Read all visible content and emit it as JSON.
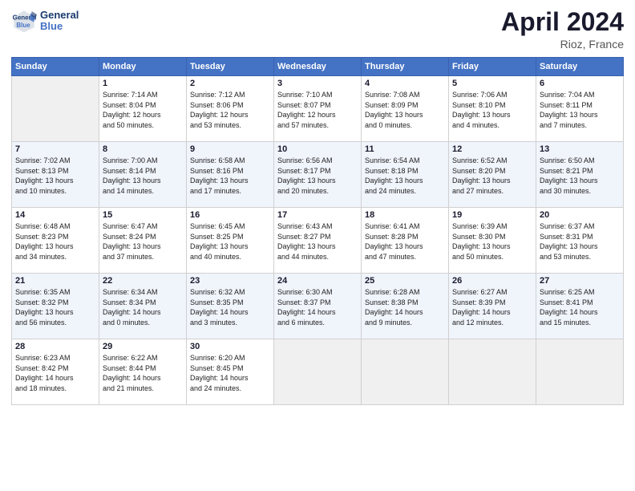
{
  "header": {
    "logo_line1": "General",
    "logo_line2": "Blue",
    "title": "April 2024",
    "location": "Rioz, France"
  },
  "days_of_week": [
    "Sunday",
    "Monday",
    "Tuesday",
    "Wednesday",
    "Thursday",
    "Friday",
    "Saturday"
  ],
  "weeks": [
    [
      {
        "day": "",
        "info": ""
      },
      {
        "day": "1",
        "info": "Sunrise: 7:14 AM\nSunset: 8:04 PM\nDaylight: 12 hours\nand 50 minutes."
      },
      {
        "day": "2",
        "info": "Sunrise: 7:12 AM\nSunset: 8:06 PM\nDaylight: 12 hours\nand 53 minutes."
      },
      {
        "day": "3",
        "info": "Sunrise: 7:10 AM\nSunset: 8:07 PM\nDaylight: 12 hours\nand 57 minutes."
      },
      {
        "day": "4",
        "info": "Sunrise: 7:08 AM\nSunset: 8:09 PM\nDaylight: 13 hours\nand 0 minutes."
      },
      {
        "day": "5",
        "info": "Sunrise: 7:06 AM\nSunset: 8:10 PM\nDaylight: 13 hours\nand 4 minutes."
      },
      {
        "day": "6",
        "info": "Sunrise: 7:04 AM\nSunset: 8:11 PM\nDaylight: 13 hours\nand 7 minutes."
      }
    ],
    [
      {
        "day": "7",
        "info": "Sunrise: 7:02 AM\nSunset: 8:13 PM\nDaylight: 13 hours\nand 10 minutes."
      },
      {
        "day": "8",
        "info": "Sunrise: 7:00 AM\nSunset: 8:14 PM\nDaylight: 13 hours\nand 14 minutes."
      },
      {
        "day": "9",
        "info": "Sunrise: 6:58 AM\nSunset: 8:16 PM\nDaylight: 13 hours\nand 17 minutes."
      },
      {
        "day": "10",
        "info": "Sunrise: 6:56 AM\nSunset: 8:17 PM\nDaylight: 13 hours\nand 20 minutes."
      },
      {
        "day": "11",
        "info": "Sunrise: 6:54 AM\nSunset: 8:18 PM\nDaylight: 13 hours\nand 24 minutes."
      },
      {
        "day": "12",
        "info": "Sunrise: 6:52 AM\nSunset: 8:20 PM\nDaylight: 13 hours\nand 27 minutes."
      },
      {
        "day": "13",
        "info": "Sunrise: 6:50 AM\nSunset: 8:21 PM\nDaylight: 13 hours\nand 30 minutes."
      }
    ],
    [
      {
        "day": "14",
        "info": "Sunrise: 6:48 AM\nSunset: 8:23 PM\nDaylight: 13 hours\nand 34 minutes."
      },
      {
        "day": "15",
        "info": "Sunrise: 6:47 AM\nSunset: 8:24 PM\nDaylight: 13 hours\nand 37 minutes."
      },
      {
        "day": "16",
        "info": "Sunrise: 6:45 AM\nSunset: 8:25 PM\nDaylight: 13 hours\nand 40 minutes."
      },
      {
        "day": "17",
        "info": "Sunrise: 6:43 AM\nSunset: 8:27 PM\nDaylight: 13 hours\nand 44 minutes."
      },
      {
        "day": "18",
        "info": "Sunrise: 6:41 AM\nSunset: 8:28 PM\nDaylight: 13 hours\nand 47 minutes."
      },
      {
        "day": "19",
        "info": "Sunrise: 6:39 AM\nSunset: 8:30 PM\nDaylight: 13 hours\nand 50 minutes."
      },
      {
        "day": "20",
        "info": "Sunrise: 6:37 AM\nSunset: 8:31 PM\nDaylight: 13 hours\nand 53 minutes."
      }
    ],
    [
      {
        "day": "21",
        "info": "Sunrise: 6:35 AM\nSunset: 8:32 PM\nDaylight: 13 hours\nand 56 minutes."
      },
      {
        "day": "22",
        "info": "Sunrise: 6:34 AM\nSunset: 8:34 PM\nDaylight: 14 hours\nand 0 minutes."
      },
      {
        "day": "23",
        "info": "Sunrise: 6:32 AM\nSunset: 8:35 PM\nDaylight: 14 hours\nand 3 minutes."
      },
      {
        "day": "24",
        "info": "Sunrise: 6:30 AM\nSunset: 8:37 PM\nDaylight: 14 hours\nand 6 minutes."
      },
      {
        "day": "25",
        "info": "Sunrise: 6:28 AM\nSunset: 8:38 PM\nDaylight: 14 hours\nand 9 minutes."
      },
      {
        "day": "26",
        "info": "Sunrise: 6:27 AM\nSunset: 8:39 PM\nDaylight: 14 hours\nand 12 minutes."
      },
      {
        "day": "27",
        "info": "Sunrise: 6:25 AM\nSunset: 8:41 PM\nDaylight: 14 hours\nand 15 minutes."
      }
    ],
    [
      {
        "day": "28",
        "info": "Sunrise: 6:23 AM\nSunset: 8:42 PM\nDaylight: 14 hours\nand 18 minutes."
      },
      {
        "day": "29",
        "info": "Sunrise: 6:22 AM\nSunset: 8:44 PM\nDaylight: 14 hours\nand 21 minutes."
      },
      {
        "day": "30",
        "info": "Sunrise: 6:20 AM\nSunset: 8:45 PM\nDaylight: 14 hours\nand 24 minutes."
      },
      {
        "day": "",
        "info": ""
      },
      {
        "day": "",
        "info": ""
      },
      {
        "day": "",
        "info": ""
      },
      {
        "day": "",
        "info": ""
      }
    ]
  ]
}
